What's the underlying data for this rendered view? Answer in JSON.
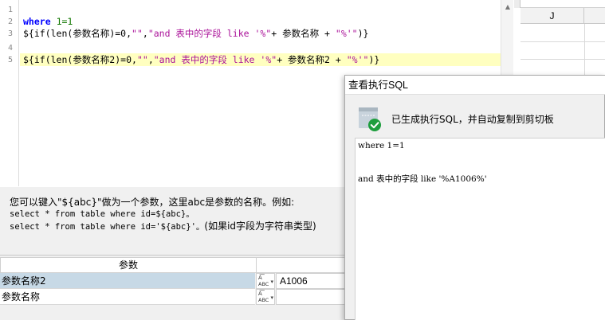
{
  "editor": {
    "line_numbers": [
      "1",
      "2",
      "3",
      "4",
      "5"
    ],
    "line2": {
      "kw": "where",
      "rest": "1=1"
    },
    "line3": {
      "p1": "${if(len(",
      "p2": "参数名称",
      "p3": ")=0,",
      "p4": "\"\"",
      "p5": ",",
      "p6": "\"and 表中的字段 like '%\"",
      "p7": "+ 参数名称 +",
      "p8": "\"%'\"",
      "p9": ")}"
    },
    "line5": {
      "p1": "${if(len(",
      "p2": "参数名称2",
      "p3": ")=0,",
      "p4": "\"\"",
      "p5": ",",
      "p6": "\"and 表中的字段 like '%\"",
      "p7": "+ 参数名称2 +",
      "p8": "\"%'\"",
      "p9": ")}"
    },
    "scroll_up_glyph": "▲"
  },
  "sheet": {
    "column_label": "J"
  },
  "help": {
    "line1": "您可以键入\"${abc}\"做为一个参数，这里abc是参数的名称。例如:",
    "line2": "select * from table where id=${abc}。",
    "line3a": "select * from table where id='${abc}'。",
    "line3b": "(如果id字段为字符串类型)"
  },
  "params": {
    "header": "参数",
    "rows": [
      {
        "name": "参数名称2",
        "type_top": "A͞",
        "type_bottom": "ABC",
        "value": "A1006",
        "selected": true
      },
      {
        "name": "参数名称",
        "type_top": "A͞",
        "type_bottom": "ABC",
        "value": "",
        "selected": false
      }
    ],
    "type_arrow": "▾"
  },
  "dialog": {
    "title": "查看执行SQL",
    "message": "已生成执行SQL，并自动复制到剪切板",
    "sql_lines": [
      "where 1=1",
      "",
      "",
      "and 表中的字段 like '%A1006%'"
    ],
    "icon_colors": {
      "doc": "#c8d3dc",
      "check": "#1e9e3e"
    }
  }
}
